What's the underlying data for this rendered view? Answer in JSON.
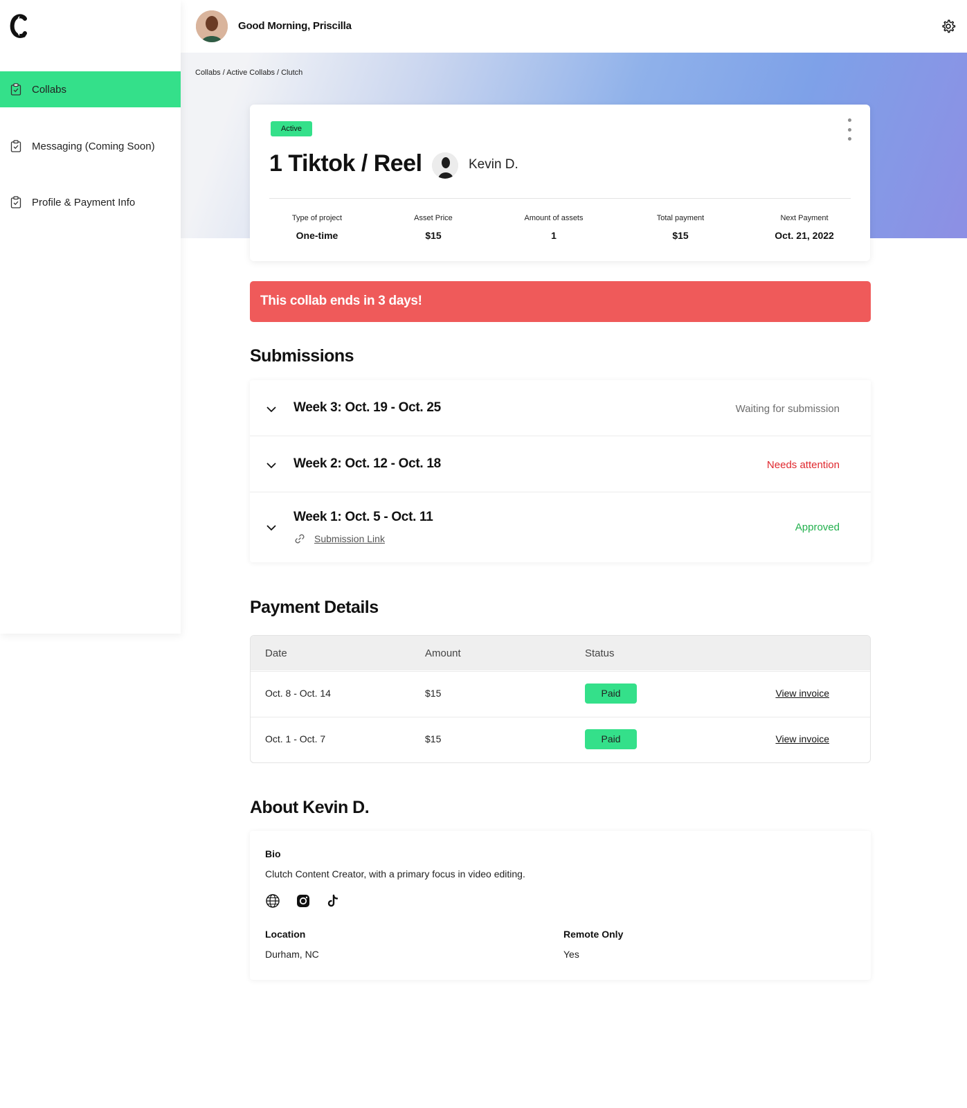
{
  "sidebar": {
    "logo_letter": "C",
    "items": [
      {
        "label": "Collabs",
        "active": true
      },
      {
        "label": "Messaging (Coming Soon)",
        "active": false
      },
      {
        "label": "Profile & Payment Info",
        "active": false
      }
    ]
  },
  "header": {
    "greeting": "Good Morning, Priscilla"
  },
  "breadcrumb": "Collabs / Active Collabs / Clutch",
  "collab": {
    "status_badge": "Active",
    "title": "1 Tiktok / Reel",
    "creator_name": "Kevin D.",
    "stats": [
      {
        "label": "Type of project",
        "value": "One-time"
      },
      {
        "label": "Asset Price",
        "value": "$15"
      },
      {
        "label": "Amount of assets",
        "value": "1"
      },
      {
        "label": "Total payment",
        "value": "$15"
      },
      {
        "label": "Next Payment",
        "value": "Oct. 21, 2022"
      }
    ]
  },
  "alert": "This collab ends in 3 days!",
  "submissions": {
    "title": "Submissions",
    "rows": [
      {
        "week": "Week 3: Oct. 19 - Oct. 25",
        "status": "Waiting for submission"
      },
      {
        "week": "Week 2: Oct. 12 - Oct. 18",
        "status": "Needs attention"
      },
      {
        "week": "Week 1: Oct. 5 - Oct. 11",
        "status": "Approved",
        "link": "Submission Link"
      }
    ]
  },
  "payments": {
    "title": "Payment Details",
    "columns": [
      "Date",
      "Amount",
      "Status"
    ],
    "rows": [
      {
        "date": "Oct. 8 - Oct. 14",
        "amount": "$15",
        "status": "Paid",
        "action": "View invoice"
      },
      {
        "date": "Oct. 1 - Oct. 7",
        "amount": "$15",
        "status": "Paid",
        "action": "View invoice"
      }
    ]
  },
  "about": {
    "title": "About Kevin D.",
    "bio_label": "Bio",
    "bio": "Clutch Content Creator, with a primary focus in video editing.",
    "socials": [
      "globe-icon",
      "instagram-icon",
      "tiktok-icon"
    ],
    "location_label": "Location",
    "location": "Durham, NC",
    "remote_label": "Remote Only",
    "remote": "Yes"
  },
  "colors": {
    "accent_green": "#34e08a",
    "alert_red": "#ef5a5a",
    "attention_red": "#e0282e",
    "approved_green": "#22b04d"
  }
}
